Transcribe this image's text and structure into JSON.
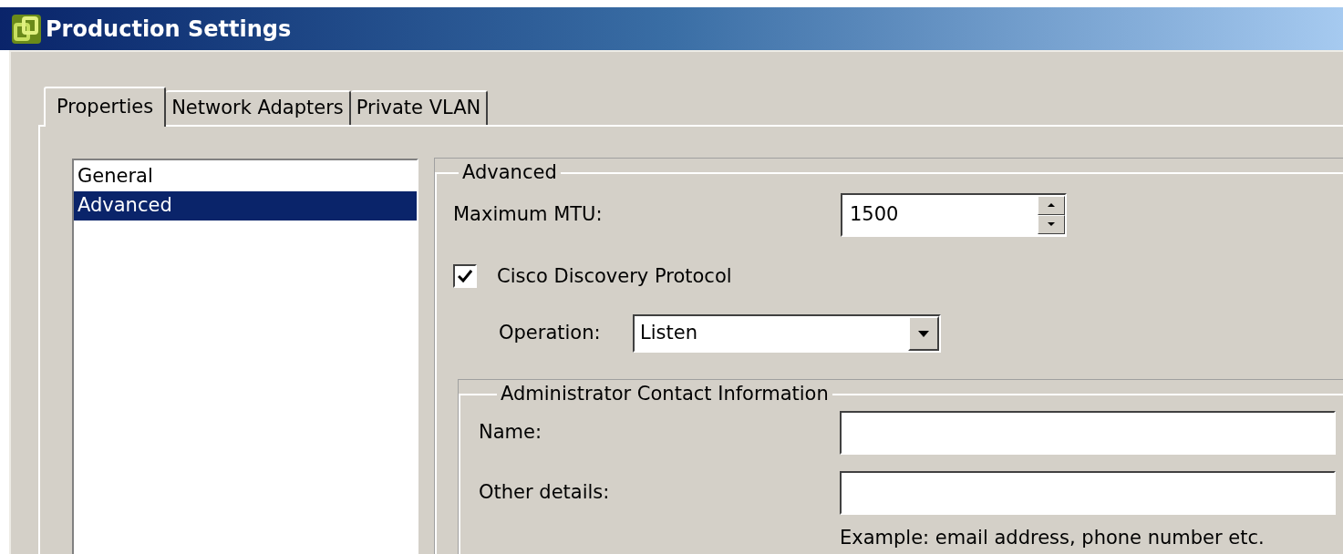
{
  "window": {
    "title": "Production Settings"
  },
  "tabs": [
    {
      "label": "Properties",
      "selected": true
    },
    {
      "label": "Network Adapters",
      "selected": false
    },
    {
      "label": "Private VLAN",
      "selected": false
    }
  ],
  "sidebar": {
    "items": [
      {
        "label": "General",
        "selected": false
      },
      {
        "label": "Advanced",
        "selected": true
      }
    ]
  },
  "advanced": {
    "title": "Advanced",
    "max_mtu": {
      "label": "Maximum MTU:",
      "value": "1500"
    },
    "cdp": {
      "label": "Cisco Discovery Protocol",
      "checked": true
    },
    "operation": {
      "label": "Operation:",
      "value": "Listen"
    },
    "contact": {
      "title": "Administrator Contact Information",
      "fields": [
        {
          "label": "Name:"
        },
        {
          "label": "Other details:"
        }
      ],
      "hint": "Example: email address, phone number etc."
    }
  }
}
